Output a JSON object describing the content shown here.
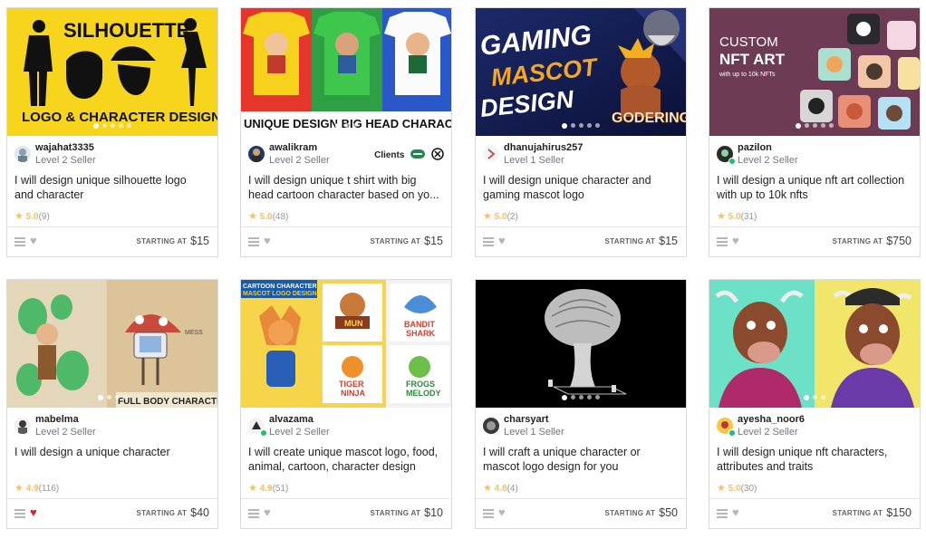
{
  "gigs": [
    {
      "seller": "wajahat3335",
      "level": "Level 2 Seller",
      "title": "I will design unique silhouette logo and character",
      "rating": "5.0",
      "reviews": "(9)",
      "price_label": "STARTING AT",
      "price": "$15",
      "liked": false,
      "image_text": [
        "SILHOUETTE",
        "LOGO & CHARACTER DESIGNS"
      ]
    },
    {
      "seller": "awalikram",
      "level": "Level 2 Seller",
      "title": "I will design unique t shirt with big head cartoon character based on yo...",
      "rating": "5.0",
      "reviews": "(48)",
      "price_label": "STARTING AT",
      "price": "$15",
      "liked": false,
      "clients_label": "Clients",
      "image_text": [
        "UNIQUE DESIGN BIG HEAD CHARACTER"
      ]
    },
    {
      "seller": "dhanujahirus257",
      "level": "Level 1 Seller",
      "title": "I will design unique character and gaming mascot logo",
      "rating": "5.0",
      "reviews": "(2)",
      "price_label": "STARTING AT",
      "price": "$15",
      "liked": false,
      "image_text": [
        "GAMING",
        "MASCOT",
        "DESIGN",
        "GODERING"
      ]
    },
    {
      "seller": "pazilon",
      "level": "Level 2 Seller",
      "title": "I will design a unique nft art collection with up to 10k nfts",
      "rating": "5.0",
      "reviews": "(31)",
      "price_label": "STARTING AT",
      "price": "$750",
      "liked": false,
      "image_text": [
        "CUSTOM",
        "NFT ART",
        "with up to 10k NFTs"
      ]
    },
    {
      "seller": "mabelma",
      "level": "Level 2 Seller",
      "title": "I will design a unique character",
      "rating": "4.9",
      "reviews": "(116)",
      "price_label": "STARTING AT",
      "price": "$40",
      "liked": true,
      "image_text": [
        "FULL BODY CHARACTERS",
        "MESS"
      ]
    },
    {
      "seller": "alvazama",
      "level": "Level 2 Seller",
      "title": "I will create unique mascot logo, food, animal, cartoon, character design",
      "rating": "4.9",
      "reviews": "(51)",
      "price_label": "STARTING AT",
      "price": "$10",
      "liked": false,
      "image_text": [
        "CARTOON CHARACTER",
        "MASCOT LOGO DESIGN",
        "MUN",
        "BANDIT",
        "SHARK",
        "TIGER",
        "NINJA",
        "FROGS",
        "MELODY"
      ]
    },
    {
      "seller": "charsyart",
      "level": "Level 1 Seller",
      "title": "I will craft a unique character or mascot logo design for you",
      "rating": "4.8",
      "reviews": "(4)",
      "price_label": "STARTING AT",
      "price": "$50",
      "liked": false,
      "image_text": []
    },
    {
      "seller": "ayesha_noor6",
      "level": "Level 2 Seller",
      "title": "I will design unique nft characters, attributes and traits",
      "rating": "5.0",
      "reviews": "(30)",
      "price_label": "STARTING AT",
      "price": "$150",
      "liked": false,
      "image_text": []
    }
  ],
  "colors": {
    "star": "#ffbe5b",
    "online": "#1dbf73",
    "heart_liked": "#e0202d",
    "border": "#dadbdd"
  },
  "icons": {
    "menu": "menu-icon",
    "heart": "heart-icon",
    "star": "star-icon"
  }
}
